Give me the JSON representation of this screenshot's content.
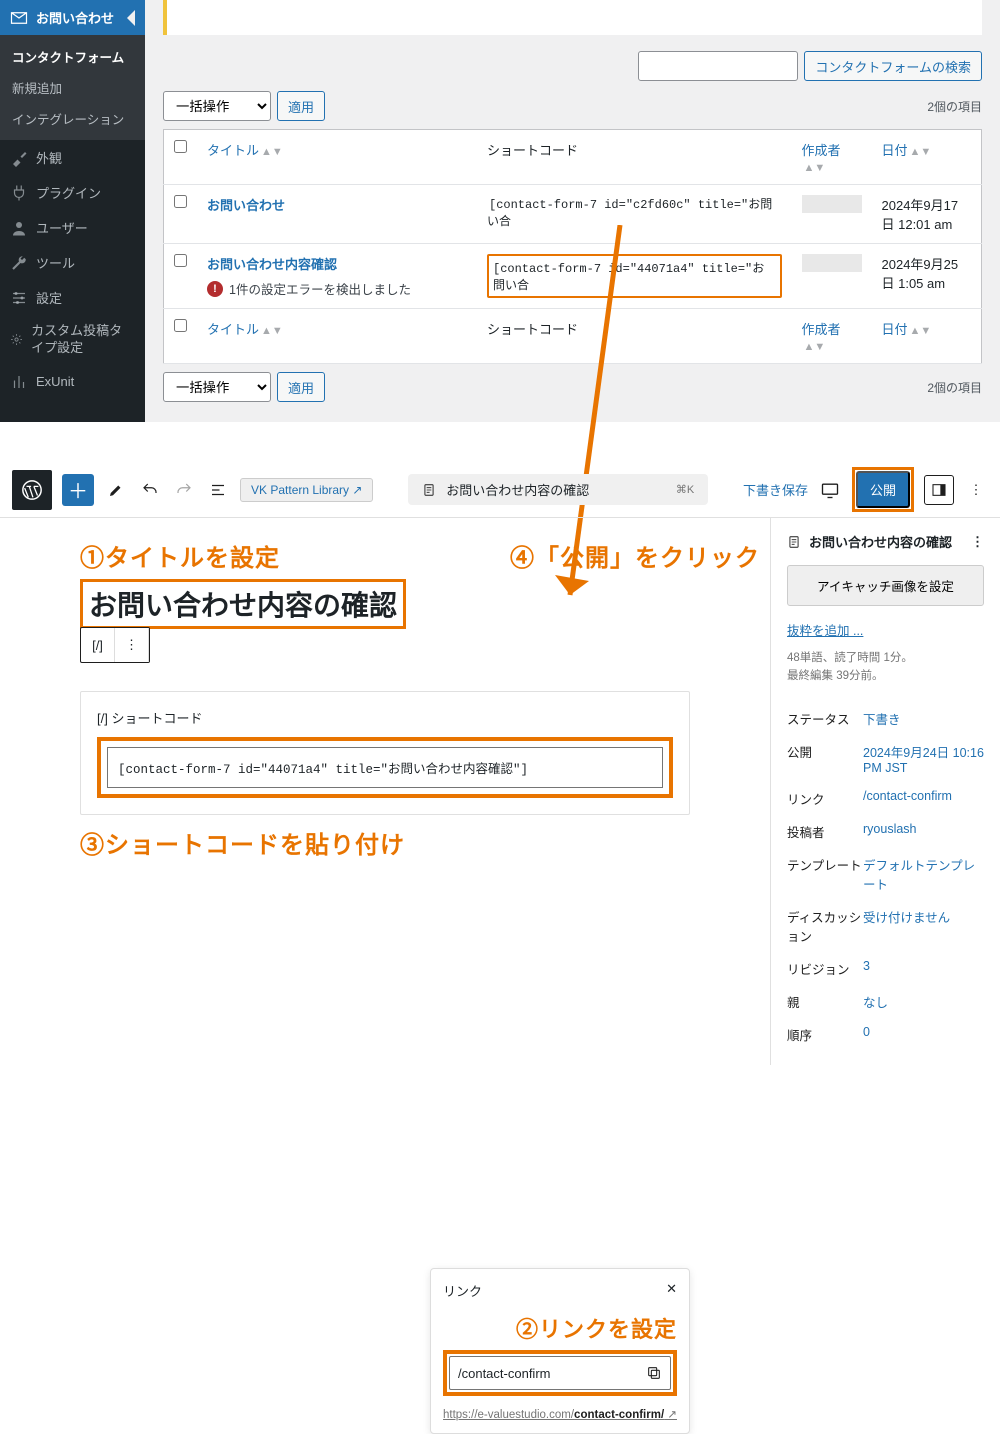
{
  "sidebar": {
    "contact": "お問い合わせ",
    "sub": [
      "コンタクトフォーム",
      "新規追加",
      "インテグレーション"
    ],
    "items": [
      {
        "icon": "brush",
        "label": "外観"
      },
      {
        "icon": "plug",
        "label": "プラグイン"
      },
      {
        "icon": "user",
        "label": "ユーザー"
      },
      {
        "icon": "wrench",
        "label": "ツール"
      },
      {
        "icon": "sliders",
        "label": "設定"
      },
      {
        "icon": "gear",
        "label": "カスタム投稿タイプ設定"
      },
      {
        "icon": "antenna",
        "label": "ExUnit"
      }
    ]
  },
  "list": {
    "search_button": "コンタクトフォームの検索",
    "bulk_label": "一括操作",
    "apply": "適用",
    "count_text": "2個の項目",
    "columns": {
      "title": "タイトル",
      "shortcode": "ショートコード",
      "author": "作成者",
      "date": "日付"
    },
    "rows": [
      {
        "title": "お問い合わせ",
        "shortcode": "[contact-form-7 id=\"c2fd60c\" title=\"お問い合",
        "date": "2024年9月17日 12:01 am"
      },
      {
        "title": "お問い合わせ内容確認",
        "error": "1件の設定エラーを検出しました",
        "shortcode": "[contact-form-7 id=\"44071a4\" title=\"お問い合",
        "date": "2024年9月25日 1:05 am"
      }
    ]
  },
  "editor": {
    "vk_button": "VK Pattern Library ↗",
    "doc_title": "お問い合わせ内容の確認",
    "cmd_k": "⌘K",
    "save_draft": "下書き保存",
    "publish": "公開",
    "annot1": "①タイトルを設定",
    "title_value": "お問い合わせ内容の確認",
    "shortcode_label": "[/] ショートコード",
    "shortcode_value": "[contact-form-7 id=\"44071a4\" title=\"お問い合わせ内容確認\"]",
    "annot3": "③ショートコードを貼り付け",
    "annot4": "④「公開」をクリック",
    "link_popover": {
      "header": "リンク",
      "annot2": "②リンクを設定",
      "value": "/contact-confirm",
      "url_prefix": "https://e-valuestudio.com/",
      "url_bold": "contact-confirm/"
    },
    "side": {
      "doc_title": "お問い合わせ内容の確認",
      "featured_btn": "アイキャッチ画像を設定",
      "excerpt": "抜粋を追加 ...",
      "meta_text": "48単語、読了時間 1分。\n最終編集 39分前。",
      "rows": [
        {
          "k": "ステータス",
          "v": "下書き"
        },
        {
          "k": "公開",
          "v": "2024年9月24日 10:16 PM JST"
        },
        {
          "k": "リンク",
          "v": "/contact-confirm"
        },
        {
          "k": "投稿者",
          "v": "ryouslash"
        },
        {
          "k": "テンプレート",
          "v": "デフォルトテンプレート"
        },
        {
          "k": "ディスカッション",
          "v": "受け付けません"
        },
        {
          "k": "リビジョン",
          "v": "3"
        },
        {
          "k": "親",
          "v": "なし"
        },
        {
          "k": "順序",
          "v": "0"
        }
      ]
    }
  }
}
